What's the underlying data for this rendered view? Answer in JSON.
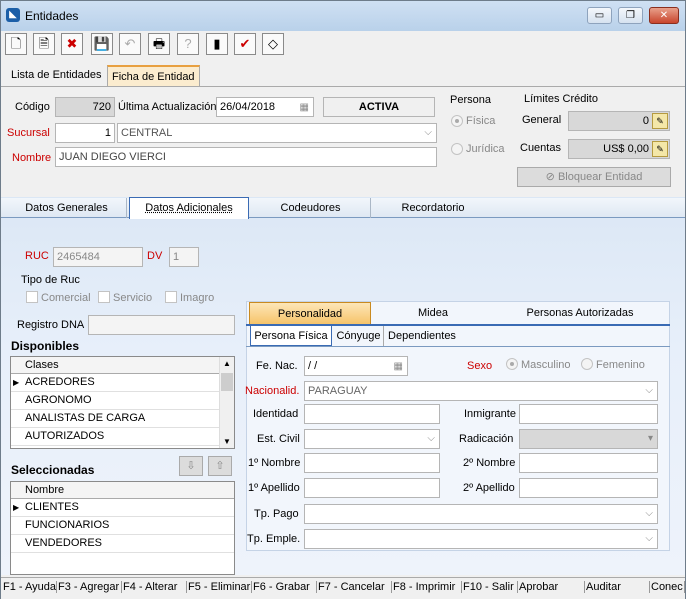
{
  "window": {
    "title": "Entidades",
    "app_icon": "app-icon",
    "min": "▭",
    "max": "❐",
    "close": "✕"
  },
  "toolbar": [
    "new-doc-icon",
    "open-doc-icon",
    "delete-doc-icon",
    "save-icon",
    "undo-icon",
    "print-icon",
    "help-icon",
    "exit-icon",
    "check-icon",
    "eraser-icon"
  ],
  "toolbar_glyphs": [
    "🗋",
    "🗎",
    "✖",
    "💾",
    "↶",
    "🖶",
    "?",
    "▮",
    "✔",
    "◇"
  ],
  "tabs": {
    "lista": "Lista de Entidades",
    "ficha": "Ficha de Entidad"
  },
  "header": {
    "codigo_label": "Código",
    "codigo": "720",
    "ultima_label": "Última Actualización",
    "ultima": "26/04/2018",
    "estado": "ACTIVA",
    "sucursal_label": "Sucursal",
    "sucursal_num": "1",
    "sucursal": "CENTRAL",
    "nombre_label": "Nombre",
    "nombre": "JUAN DIEGO VIERCI",
    "persona_label": "Persona",
    "fisica": "Física",
    "juridica": "Jurídica",
    "limites_label": "Límites Crédito",
    "general_label": "General",
    "general": "0",
    "cuentas_label": "Cuentas",
    "cuentas": "US$ 0,00",
    "bloquear": "Bloquear Entidad"
  },
  "maintabs": [
    "Datos Generales",
    "Datos Adicionales",
    "Codeudores",
    "Recordatorio"
  ],
  "adicionales": {
    "ruc_label": "RUC",
    "ruc": "2465484",
    "dv_label": "DV",
    "dv": "1",
    "tipo_ruc_label": "Tipo de Ruc",
    "comercial": "Comercial",
    "servicio": "Servicio",
    "imagro": "Imagro",
    "registro_label": "Registro DNA",
    "registro": ""
  },
  "disponibles": {
    "title": "Disponibles",
    "header": "Clases",
    "rows": [
      "ACREDORES",
      "AGRONOMO",
      "ANALISTAS DE CARGA",
      "AUTORIZADOS"
    ]
  },
  "seleccionadas": {
    "title": "Seleccionadas",
    "header": "Nombre",
    "rows": [
      "CLIENTES",
      "FUNCIONARIOS",
      "VENDEDORES"
    ]
  },
  "subtabs1": [
    "Personalidad",
    "Midea",
    "Personas Autorizadas"
  ],
  "subtabs2": [
    "Persona Física",
    "Cónyuge",
    "Dependientes"
  ],
  "persona": {
    "fenac_label": "Fe. Nac.",
    "fenac": " / /",
    "sexo_label": "Sexo",
    "masculino": "Masculino",
    "femenino": "Femenino",
    "nacionalidad_label": "Nacionalid.",
    "nacionalidad": "PARAGUAY",
    "identidad_label": "Identidad",
    "inmigrante_label": "Inmigrante",
    "estcivil_label": "Est. Civil",
    "radicacion_label": "Radicación",
    "nombre1_label": "1º Nombre",
    "nombre2_label": "2º Nombre",
    "apellido1_label": "1º Apellido",
    "apellido2_label": "2º Apellido",
    "tppago_label": "Tp. Pago",
    "tpemple_label": "Tp. Emple."
  },
  "fkeys": [
    "F1 - Ayuda",
    "F3 - Agregar",
    "F4 - Alterar",
    "F5 - Eliminar",
    "F6 - Grabar",
    "F7 - Cancelar",
    "F8 - Imprimir",
    "F10 - Salir",
    "Aprobar",
    "Auditar",
    "Conec"
  ]
}
